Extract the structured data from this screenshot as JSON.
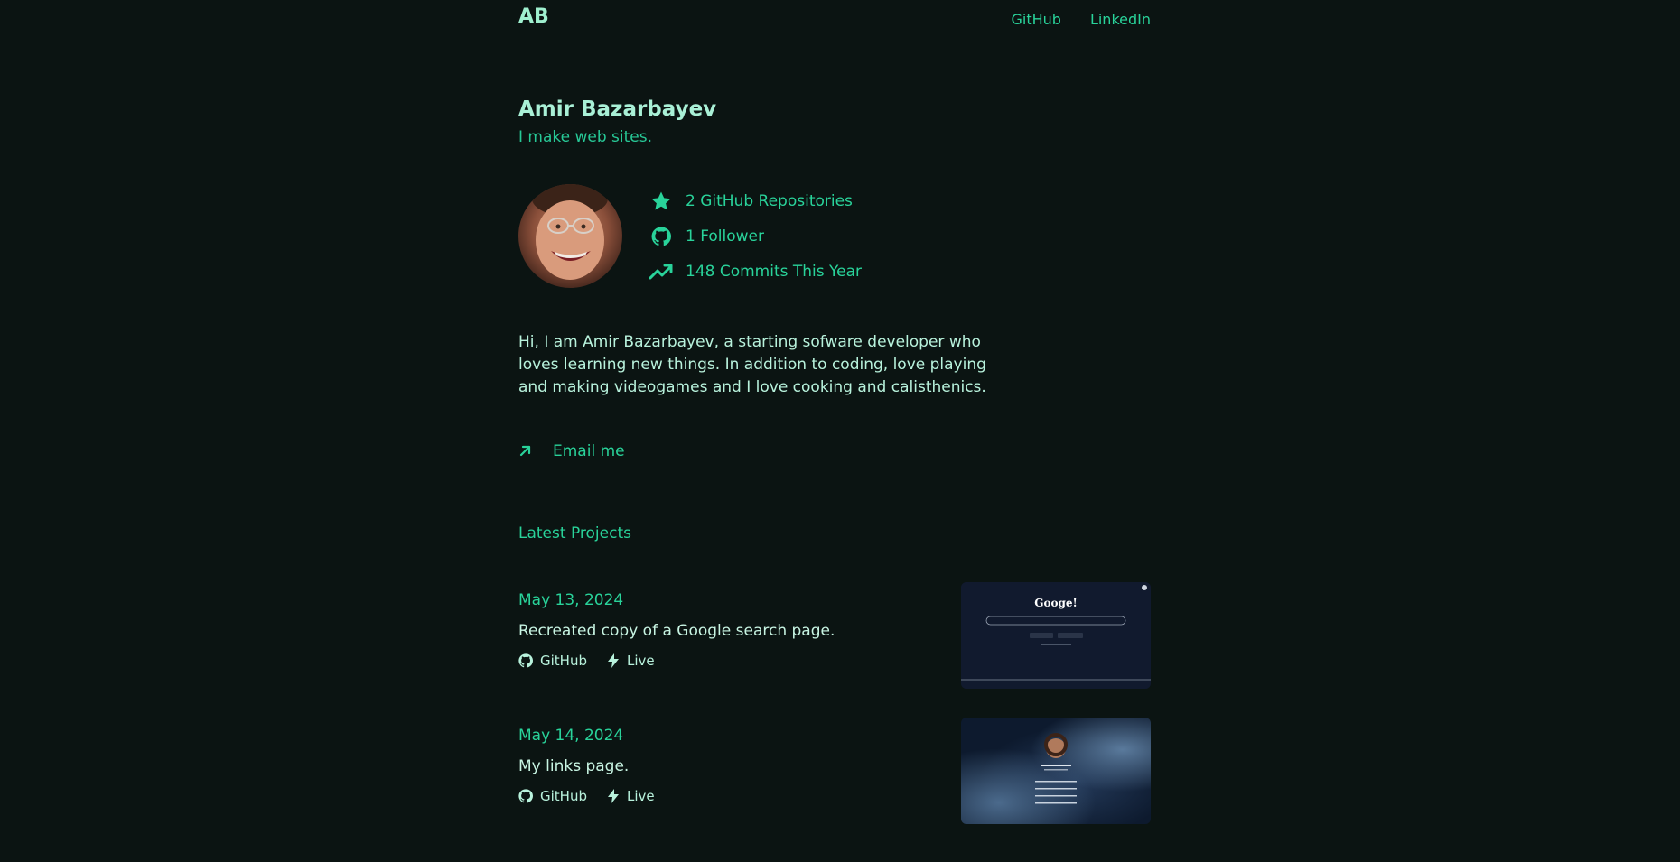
{
  "header": {
    "logo": "AB",
    "links": [
      "GitHub",
      "LinkedIn"
    ]
  },
  "profile": {
    "name": "Amir Bazarbayev",
    "tagline": "I make web sites.",
    "stats": [
      {
        "icon": "star-icon",
        "label": "2 GitHub Repositories"
      },
      {
        "icon": "github-icon",
        "label": "1 Follower"
      },
      {
        "icon": "trending-up-icon",
        "label": "148 Commits This Year"
      }
    ]
  },
  "bio": "Hi, I am Amir Bazarbayev, a starting sofware developer who loves learning new things. In addition to coding, love playing and making videogames and I love cooking and calisthenics.",
  "email_label": "Email me",
  "latest_heading": "Latest Projects",
  "projects": [
    {
      "date": "May 13, 2024",
      "description": "Recreated copy of a Google search page.",
      "github_label": "GitHub",
      "live_label": "Live",
      "thumb_title": "Googe!"
    },
    {
      "date": "May 14, 2024",
      "description": "My links page.",
      "github_label": "GitHub",
      "live_label": "Live"
    }
  ],
  "colors": {
    "background": "#0b1412",
    "accent": "#29d39a",
    "heading": "#a9f0d6",
    "text": "#b8f2dc"
  }
}
